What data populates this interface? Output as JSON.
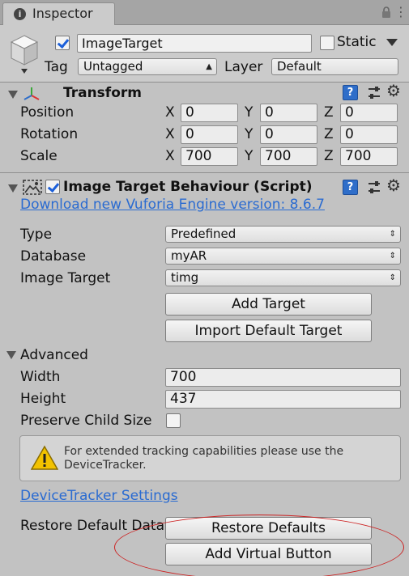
{
  "tab": {
    "icon": "info-icon",
    "title": "Inspector"
  },
  "tab_icons": {
    "lock": "lock-icon",
    "menu": "menu-icon"
  },
  "header": {
    "active": true,
    "name": "ImageTarget",
    "static_label": "Static",
    "static_checked": false,
    "tag_label": "Tag",
    "tag_value": "Untagged",
    "layer_label": "Layer",
    "layer_value": "Default"
  },
  "transform": {
    "title": "Transform",
    "rows": [
      {
        "label": "Position",
        "x": "0",
        "y": "0",
        "z": "0"
      },
      {
        "label": "Rotation",
        "x": "0",
        "y": "0",
        "z": "0"
      },
      {
        "label": "Scale",
        "x": "700",
        "y": "700",
        "z": "700"
      }
    ],
    "axis_labels": [
      "X",
      "Y",
      "Z"
    ]
  },
  "behaviour": {
    "title": "Image Target Behaviour (Script)",
    "enabled": true,
    "download_link": "Download new Vuforia Engine version: 8.6.7",
    "type_label": "Type",
    "type_value": "Predefined",
    "database_label": "Database",
    "database_value": "myAR",
    "image_target_label": "Image Target",
    "image_target_value": "timg",
    "add_target_button": "Add Target",
    "import_default_button": "Import Default Target",
    "advanced_label": "Advanced",
    "width_label": "Width",
    "width_value": "700",
    "height_label": "Height",
    "height_value": "437",
    "preserve_label": "Preserve Child Size",
    "preserve_checked": false,
    "help_text_line1": "For extended tracking capabilities please use the",
    "help_text_line2": "DeviceTracker.",
    "device_tracker_link": "DeviceTracker Settings",
    "restore_label": "Restore Default Data",
    "restore_button": "Restore Defaults",
    "add_virtual_button": "Add Virtual Button"
  },
  "colors": {
    "link": "#2a6bd1",
    "highlight": "#cc2020",
    "help_icon": "#2f6ec9"
  }
}
